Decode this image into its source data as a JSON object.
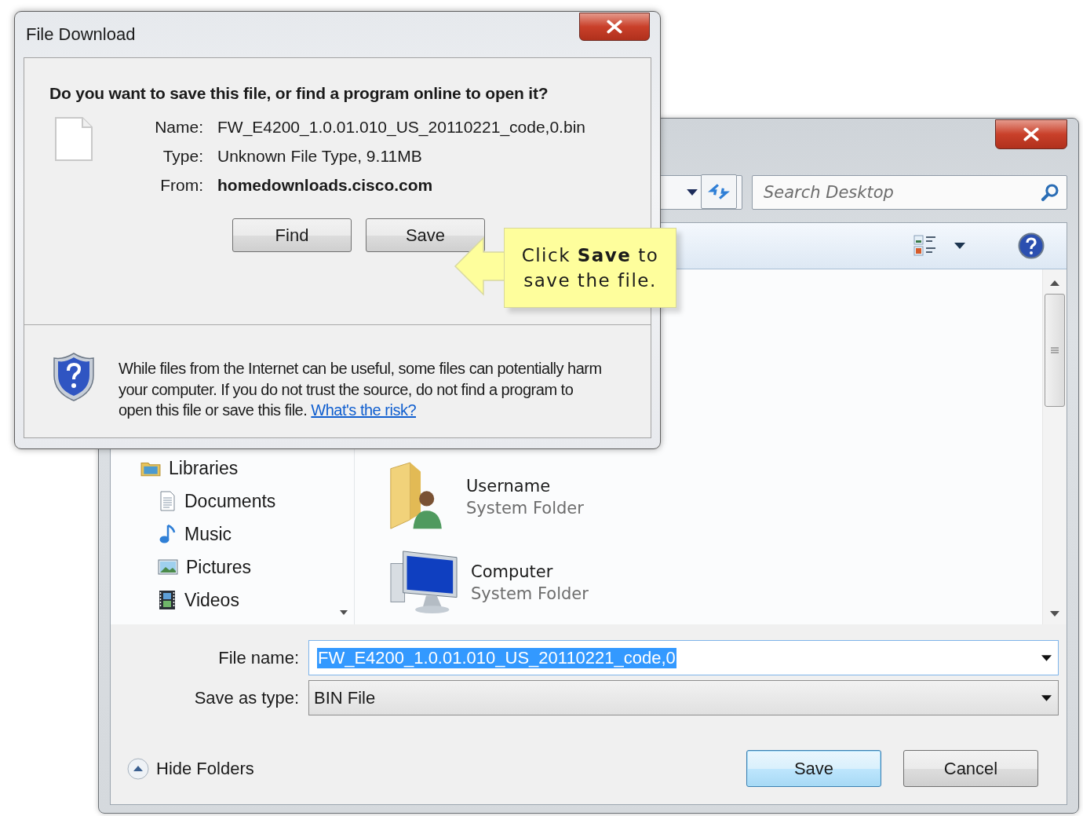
{
  "save_as": {
    "search": {
      "placeholder": "Search Desktop"
    },
    "navigation": [
      {
        "label": "Libraries",
        "kind": "libraries",
        "children": [
          {
            "label": "Documents",
            "kind": "documents"
          },
          {
            "label": "Music",
            "kind": "music"
          },
          {
            "label": "Pictures",
            "kind": "pictures"
          },
          {
            "label": "Videos",
            "kind": "videos"
          }
        ]
      }
    ],
    "items": [
      {
        "name": "Username",
        "type": "System Folder",
        "kind": "user"
      },
      {
        "name": "Computer",
        "type": "System Folder",
        "kind": "computer"
      }
    ],
    "file_name": {
      "label": "File name:",
      "value": "FW_E4200_1.0.01.010_US_20110221_code,0",
      "text_selected": true
    },
    "save_as_type": {
      "label": "Save as type:",
      "value": "BIN File"
    },
    "hide_folders": "Hide Folders",
    "buttons": [
      {
        "label": "Save",
        "default": true
      },
      {
        "label": "Cancel",
        "default": false
      }
    ]
  },
  "file_download": {
    "title": "File Download",
    "question": "Do you want to save this file, or find a program online to open it?",
    "details": [
      {
        "label": "Name:",
        "value": "FW_E4200_1.0.01.010_US_20110221_code,0.bin",
        "bold": false
      },
      {
        "label": "Type:",
        "value": "Unknown File Type, 9.11MB",
        "bold": false
      },
      {
        "label": "From:",
        "value": "homedownloads.cisco.com",
        "bold": true
      }
    ],
    "buttons": [
      "Find",
      "Save"
    ],
    "warning": "While files from the Internet can be useful, some files can potentially harm your computer. If you do not trust the source, do not find a program to open this file or save this file.",
    "risk_link": "What's the risk?"
  },
  "callout": {
    "text": "Click **Save** to save the file."
  }
}
